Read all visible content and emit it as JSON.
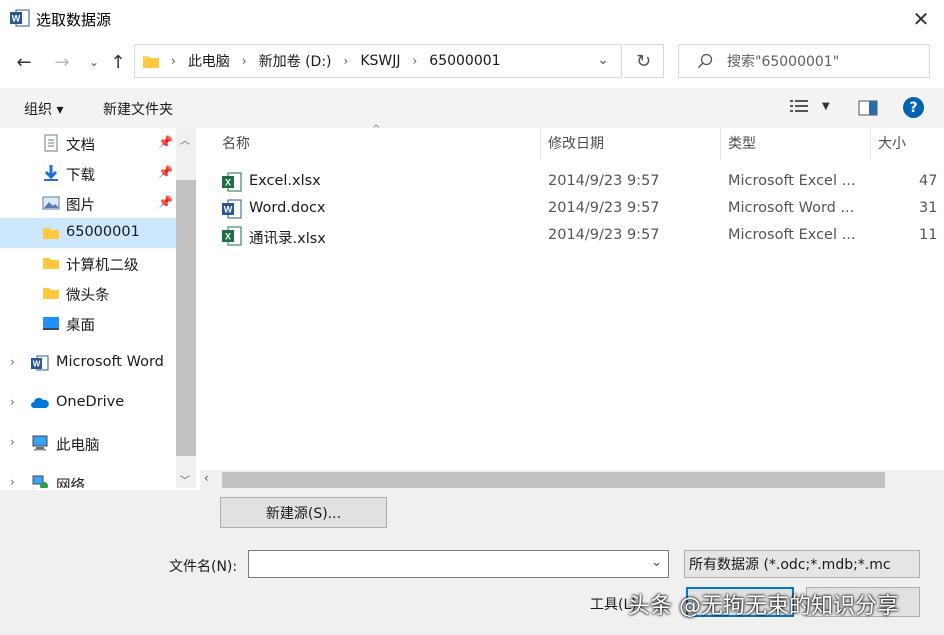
{
  "window": {
    "title": "选取数据源",
    "app_icon": "word-icon"
  },
  "nav": {
    "breadcrumb": [
      "此电脑",
      "新加卷 (D:)",
      "KSWJJ",
      "65000001"
    ],
    "search_placeholder": "搜索\"65000001\""
  },
  "toolbar": {
    "organize": "组织 ▾",
    "new_folder": "新建文件夹"
  },
  "sidebar": {
    "quick": [
      {
        "label": "文档",
        "icon": "document-icon",
        "pinned": true
      },
      {
        "label": "下载",
        "icon": "download-icon",
        "pinned": true
      },
      {
        "label": "图片",
        "icon": "pictures-icon",
        "pinned": true
      },
      {
        "label": "65000001",
        "icon": "folder-icon",
        "selected": true
      },
      {
        "label": "计算机二级",
        "icon": "folder-icon"
      },
      {
        "label": "微头条",
        "icon": "folder-icon"
      },
      {
        "label": "桌面",
        "icon": "desktop-icon"
      }
    ],
    "roots": [
      {
        "label": "Microsoft Word",
        "icon": "word-icon"
      },
      {
        "label": "OneDrive",
        "icon": "cloud-icon"
      },
      {
        "label": "此电脑",
        "icon": "computer-icon"
      },
      {
        "label": "网络",
        "icon": "network-icon"
      }
    ]
  },
  "columns": {
    "name": "名称",
    "date": "修改日期",
    "type": "类型",
    "size": "大小"
  },
  "files": [
    {
      "name": "Excel.xlsx",
      "date": "2014/9/23 9:57",
      "type": "Microsoft Excel ...",
      "size": "47",
      "icon": "excel-file-icon"
    },
    {
      "name": "Word.docx",
      "date": "2014/9/23 9:57",
      "type": "Microsoft Word ...",
      "size": "31",
      "icon": "word-file-icon"
    },
    {
      "name": "通讯录.xlsx",
      "date": "2014/9/23 9:57",
      "type": "Microsoft Excel ...",
      "size": "11",
      "icon": "excel-file-icon"
    }
  ],
  "bottom": {
    "new_source": "新建源(S)...",
    "filename_label": "文件名(N):",
    "filename_value": "",
    "filetype": "所有数据源 (*.odc;*.mdb;*.mc",
    "tools": "工具(L)"
  },
  "watermark": "头条 @无拘无束的知识分享",
  "colors": {
    "selected_bg": "#cce8ff",
    "accent": "#0078d7",
    "excel_green": "#1d7044",
    "word_blue": "#2b579a"
  }
}
